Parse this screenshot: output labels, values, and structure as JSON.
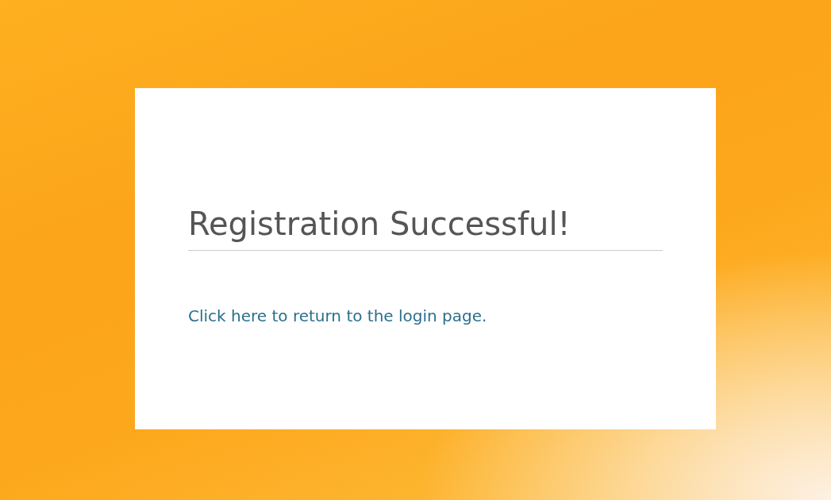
{
  "card": {
    "title": "Registration Successful!",
    "link": "Click here to return to the login page."
  }
}
